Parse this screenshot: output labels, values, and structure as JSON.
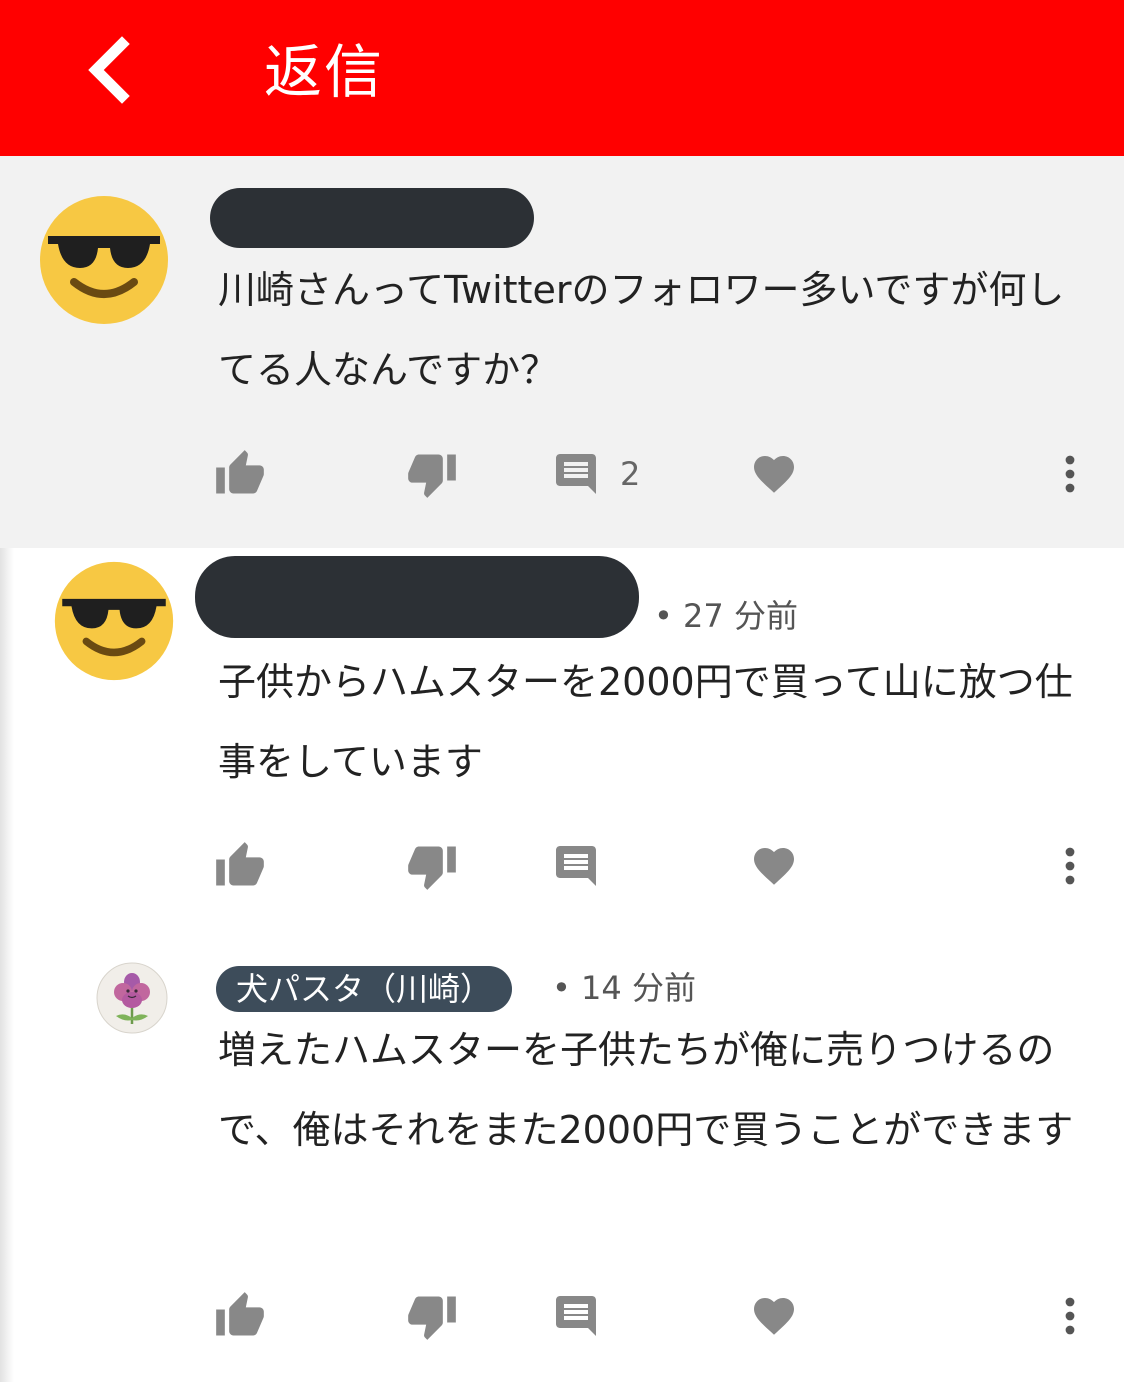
{
  "header": {
    "title": "返信",
    "back_icon": "chevron-left-icon",
    "background": "#ff0000"
  },
  "comments": [
    {
      "author_visible": false,
      "time": "",
      "text": "川崎さんってTwitterのフォロワー多いですが何してる人なんですか？",
      "reply_count": "2",
      "avatar_icon": "sunglasses-face-icon"
    },
    {
      "author_visible": false,
      "time": "• 27 分前",
      "text": "子供からハムスターを2000円で買って山に放つ仕事をしています",
      "reply_count": "",
      "avatar_icon": "sunglasses-face-icon"
    },
    {
      "author": "犬パスタ（川崎）",
      "time": "• 14 分前",
      "text": "増えたハムスターを子供たちが俺に売りつけるので、俺はそれをまた2000円で買うことができます",
      "reply_count": "",
      "avatar_icon": "flower-avatar-icon"
    }
  ],
  "actions": {
    "like_icon": "thumbs-up-icon",
    "dislike_icon": "thumbs-down-icon",
    "reply_icon": "comment-icon",
    "heart_icon": "heart-icon",
    "more_icon": "more-vertical-icon",
    "icon_color": "#888888"
  },
  "colors": {
    "highlight_background": "#f2f2f2",
    "name_pill": "#3d4c5a",
    "redaction": "#2c3035"
  }
}
